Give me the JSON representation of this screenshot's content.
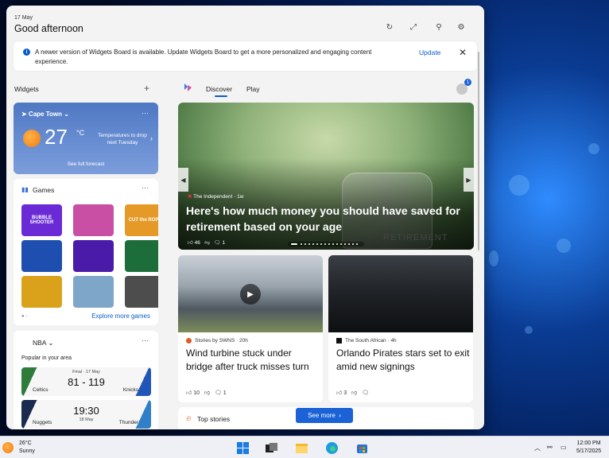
{
  "header": {
    "date": "17 May",
    "greeting": "Good afternoon",
    "buttons": [
      "refresh",
      "expand",
      "pin",
      "settings"
    ]
  },
  "notice": {
    "text": "A newer version of Widgets Board is available. Update Widgets Board to get a more personalized and engaging content experience.",
    "action": "Update"
  },
  "widgets": {
    "title": "Widgets",
    "weather": {
      "location": "Cape Town",
      "temp": "27",
      "unit": "°C",
      "note": "Temperatures to drop next Tuesday",
      "link": "See full forecast"
    },
    "games": {
      "title": "Games",
      "more": "Explore more games",
      "tiles": [
        {
          "name": "bubble-shooter",
          "label": "BUBBLE SHOOTER",
          "color": "#6a2ad6"
        },
        {
          "name": "brush-game",
          "label": "",
          "color": "#c94fa5"
        },
        {
          "name": "cut-the-rope",
          "label": "CUT the ROPE",
          "color": "#e59a27"
        },
        {
          "name": "block-puzzle",
          "label": "",
          "color": "#1e4fb0"
        },
        {
          "name": "paper-plane",
          "label": "",
          "color": "#4a1aa8"
        },
        {
          "name": "mahjong",
          "label": "",
          "color": "#1d6d3a"
        },
        {
          "name": "car-crash",
          "label": "",
          "color": "#d9a21a"
        },
        {
          "name": "rally-car",
          "label": "",
          "color": "#7da6c9"
        },
        {
          "name": "taxi-parking",
          "label": "",
          "color": "#4d4d4d"
        }
      ]
    },
    "nba": {
      "title": "NBA",
      "subtitle": "Popular in your area",
      "games": [
        {
          "status": "Final · 17 May",
          "score": "81 - 119",
          "team1": "Celtics",
          "team2": "Knicks"
        },
        {
          "status": "18 May",
          "score": "19:30",
          "team1": "Nuggets",
          "team2": "Thunder"
        }
      ]
    }
  },
  "feed": {
    "tabs": [
      "Discover",
      "Play"
    ],
    "avatar_badge": "1",
    "hero": {
      "source": "The Independent · 1w",
      "title": "Here's how much money you should have saved for retirement based on your age",
      "likes": "46",
      "comments": "1",
      "jar_label": "RETIREMENT"
    },
    "stories": [
      {
        "source": "Stories by SWNS · 20h",
        "title": "Wind turbine stuck under bridge after truck misses turn",
        "likes": "10",
        "comments": "1",
        "src_color": "#e05a2a"
      },
      {
        "source": "The South African · 4h",
        "title": "Orlando Pirates stars set to exit amid new signings",
        "likes": "3",
        "comments": "",
        "src_color": "#111111"
      }
    ],
    "top_stories": "Top stories",
    "see_more": "See more"
  },
  "taskbar": {
    "temp": "26°C",
    "condition": "Sunny",
    "time": "12:00 PM",
    "date": "5/17/2025"
  }
}
